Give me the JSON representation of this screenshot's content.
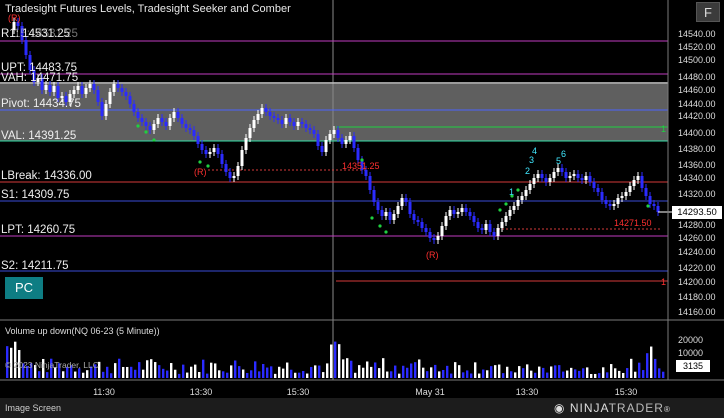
{
  "chart": {
    "title": "Tradesight Futures Levels, Tradesight Seeker and Comber",
    "f_button": "F",
    "pc_button": "PC",
    "volume_title": "Volume up down(NQ 06-23 (5 Minute))",
    "copyright": "© 2023 NinjaTrader, LLC",
    "current_price": "14293.50",
    "current_volume": "3135",
    "overlap_label": "15:14531.25"
  },
  "levels": [
    {
      "id": "r1",
      "label": "R1: 14531.25"
    },
    {
      "id": "upt",
      "label": "UPT: 14483.75"
    },
    {
      "id": "vah",
      "label": "VAH: 14471.75"
    },
    {
      "id": "pivot",
      "label": "Pivot: 14434.75"
    },
    {
      "id": "val",
      "label": "VAL: 14391.25"
    },
    {
      "id": "lbreak",
      "label": "LBreak: 14336.00"
    },
    {
      "id": "s1",
      "label": "S1: 14309.75"
    },
    {
      "id": "lpt",
      "label": "LPT: 14260.75"
    },
    {
      "id": "s2",
      "label": "S2: 14211.75"
    }
  ],
  "price_axis": [
    "14540.00",
    "14520.00",
    "14500.00",
    "14480.00",
    "14460.00",
    "14440.00",
    "14420.00",
    "14400.00",
    "14380.00",
    "14360.00",
    "14340.00",
    "14320.00",
    "14280.00",
    "14260.00",
    "14240.00",
    "14220.00",
    "14200.00",
    "14180.00",
    "14160.00"
  ],
  "volume_axis": [
    "20000",
    "10000"
  ],
  "time_axis": [
    "11:30",
    "13:30",
    "15:30",
    "May 31",
    "13:30",
    "15:30"
  ],
  "annotations": {
    "r_marks": [
      "(R)",
      "(R)",
      "(R)"
    ],
    "price_labels": [
      "14351.25",
      "14271.50"
    ],
    "seq_numbers": [
      "1",
      "2",
      "3",
      "4",
      "5",
      "6"
    ],
    "right_markers": [
      "1",
      "1"
    ]
  },
  "status_bar": {
    "text": "Image Screen",
    "brand_main": "NINJA",
    "brand_sub": "TRADER",
    "brand_reg": "®"
  },
  "colors": {
    "background": "#000000",
    "up_bar": "#ffffff",
    "down_bar": "#2b2bff",
    "value_area": "#9a9a9a",
    "r1": "#c03cc0",
    "upt": "#c03cc0",
    "vah": "#d9d9d9",
    "pivot": "#4b63ff",
    "val": "#34e0a8",
    "lbreak": "#d43a3a",
    "s1": "#3a4dd6",
    "lpt": "#c03cc0",
    "s2": "#3a4dd6",
    "signal_red": "#ff3030",
    "signal_green": "#1fd040",
    "signal_cyan": "#40e8ff"
  }
}
